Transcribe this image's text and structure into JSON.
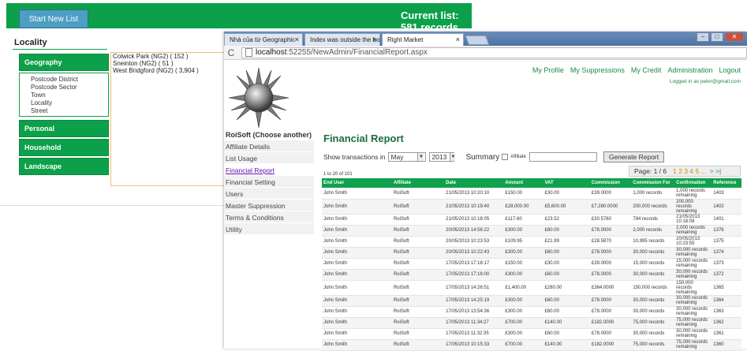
{
  "background_app": {
    "start_button": "Start New List",
    "current_list": "Current list: 581 records",
    "locality_title": "Locality",
    "nav": [
      {
        "label": "Geography",
        "subs": [
          "Postcode District",
          "Postcode Sector",
          "Town",
          "Locality",
          "Street"
        ]
      },
      {
        "label": "Personal"
      },
      {
        "label": "Household"
      },
      {
        "label": "Landscape"
      }
    ],
    "list_items": [
      "Colwick Park (NG2) ( 152 )",
      "Sneinton (NG2) ( 51 )",
      "West Bridgford (NG2) ( 3,904 )"
    ]
  },
  "browser": {
    "tabs": [
      {
        "label": "Nhà của từ Geographic"
      },
      {
        "label": "Index was outside the bou"
      },
      {
        "label": "Right Market"
      }
    ],
    "url_host": "localhost",
    "url_rest": ":52255/NewAdmin/FinancialReport.aspx"
  },
  "site": {
    "top_nav": [
      "My Profile",
      "My Suppressions",
      "My Credit",
      "Administration",
      "Logout"
    ],
    "logged_in": "Logged in as peter@gmail.com",
    "account": "RoiSoft  (Choose another)",
    "sidebar": [
      "Affiliate Details",
      "List Usage",
      "Financial Report",
      "Financial Setting",
      "Users",
      "Master Suppression",
      "Terms & Conditions",
      "Utility"
    ],
    "active_sidebar": "Financial Report",
    "page_title": "Financial Report",
    "filters": {
      "show_label": "Show transactions in",
      "month": "May",
      "year": "2013",
      "summary_label": "Summary",
      "affiliate_label": "Affiliate",
      "affiliate_value": "",
      "generate": "Generate Report"
    },
    "pager": {
      "page": "Page: 1 / 6",
      "numbers": "1 2 3 4 5 ...",
      "next": "> >|"
    },
    "range_text": "1 to 20 of 101",
    "columns": [
      "End User",
      "Affiliate",
      "Date",
      "Amount",
      "VAT",
      "Commission",
      "Commission For",
      "Confirmation",
      "Reference"
    ],
    "rows": [
      [
        "John Smith",
        "RoiSoft",
        "21/05/2013 10:20:10",
        "£150.00",
        "£30.00",
        "£39.0000",
        "1,000 records",
        "1,000 records remaining",
        "1403"
      ],
      [
        "John Smith",
        "RoiSoft",
        "21/05/2013 10:19:40",
        "£28,000.00",
        "£5,600.00",
        "£7,280.0000",
        "200,000 records",
        "200,000 records remaining",
        "1402"
      ],
      [
        "John Smith",
        "RoiSoft",
        "21/05/2013 10:18:05",
        "£117.60",
        "£23.52",
        "£30.5760",
        "784 records",
        "21/05/2013 10:18:08",
        "1401"
      ],
      [
        "John Smith",
        "RoiSoft",
        "20/05/2013 14:56:22",
        "£300.00",
        "£60.00",
        "£78.0000",
        "2,000 records",
        "2,000 records remaining",
        "1376"
      ],
      [
        "John Smith",
        "RoiSoft",
        "20/05/2013 10:23:53",
        "£109.95",
        "£21.99",
        "£28.5870",
        "10,995 records",
        "20/05/2013 10:23:55",
        "1375"
      ],
      [
        "John Smith",
        "RoiSoft",
        "20/05/2013 10:22:43",
        "£300.00",
        "£60.00",
        "£78.0000",
        "30,000 records",
        "30,000 records remaining",
        "1374"
      ],
      [
        "John Smith",
        "RoiSoft",
        "17/05/2013 17:18:17",
        "£150.00",
        "£30.00",
        "£39.0000",
        "15,000 records",
        "15,000 records remaining",
        "1373"
      ],
      [
        "John Smith",
        "RoiSoft",
        "17/05/2013 17:16:00",
        "£300.00",
        "£60.00",
        "£78.0000",
        "30,000 records",
        "30,000 records remaining",
        "1372"
      ],
      [
        "John Smith",
        "RoiSoft",
        "17/05/2013 14:26:51",
        "£1,400.00",
        "£280.00",
        "£364.0000",
        "150,000 records",
        "150,000 records remaining",
        "1365"
      ],
      [
        "John Smith",
        "RoiSoft",
        "17/05/2013 14:25:19",
        "£300.00",
        "£60.00",
        "£78.0000",
        "30,000 records",
        "30,000 records remaining",
        "1364"
      ],
      [
        "John Smith",
        "RoiSoft",
        "17/05/2013 13:54:36",
        "£300.00",
        "£60.00",
        "£78.0000",
        "30,000 records",
        "30,000 records remaining",
        "1363"
      ],
      [
        "John Smith",
        "RoiSoft",
        "17/05/2013 11:34:27",
        "£700.00",
        "£140.00",
        "£182.0000",
        "75,000 records",
        "75,000 records remaining",
        "1362"
      ],
      [
        "John Smith",
        "RoiSoft",
        "17/05/2013 11:32:35",
        "£300.00",
        "£60.00",
        "£78.0000",
        "30,000 records",
        "30,000 records remaining",
        "1361"
      ],
      [
        "John Smith",
        "RoiSoft",
        "17/05/2013 10:15:33",
        "£700.00",
        "£140.00",
        "£182.0000",
        "75,000 records",
        "75,000 records remaining",
        "1360"
      ]
    ]
  }
}
